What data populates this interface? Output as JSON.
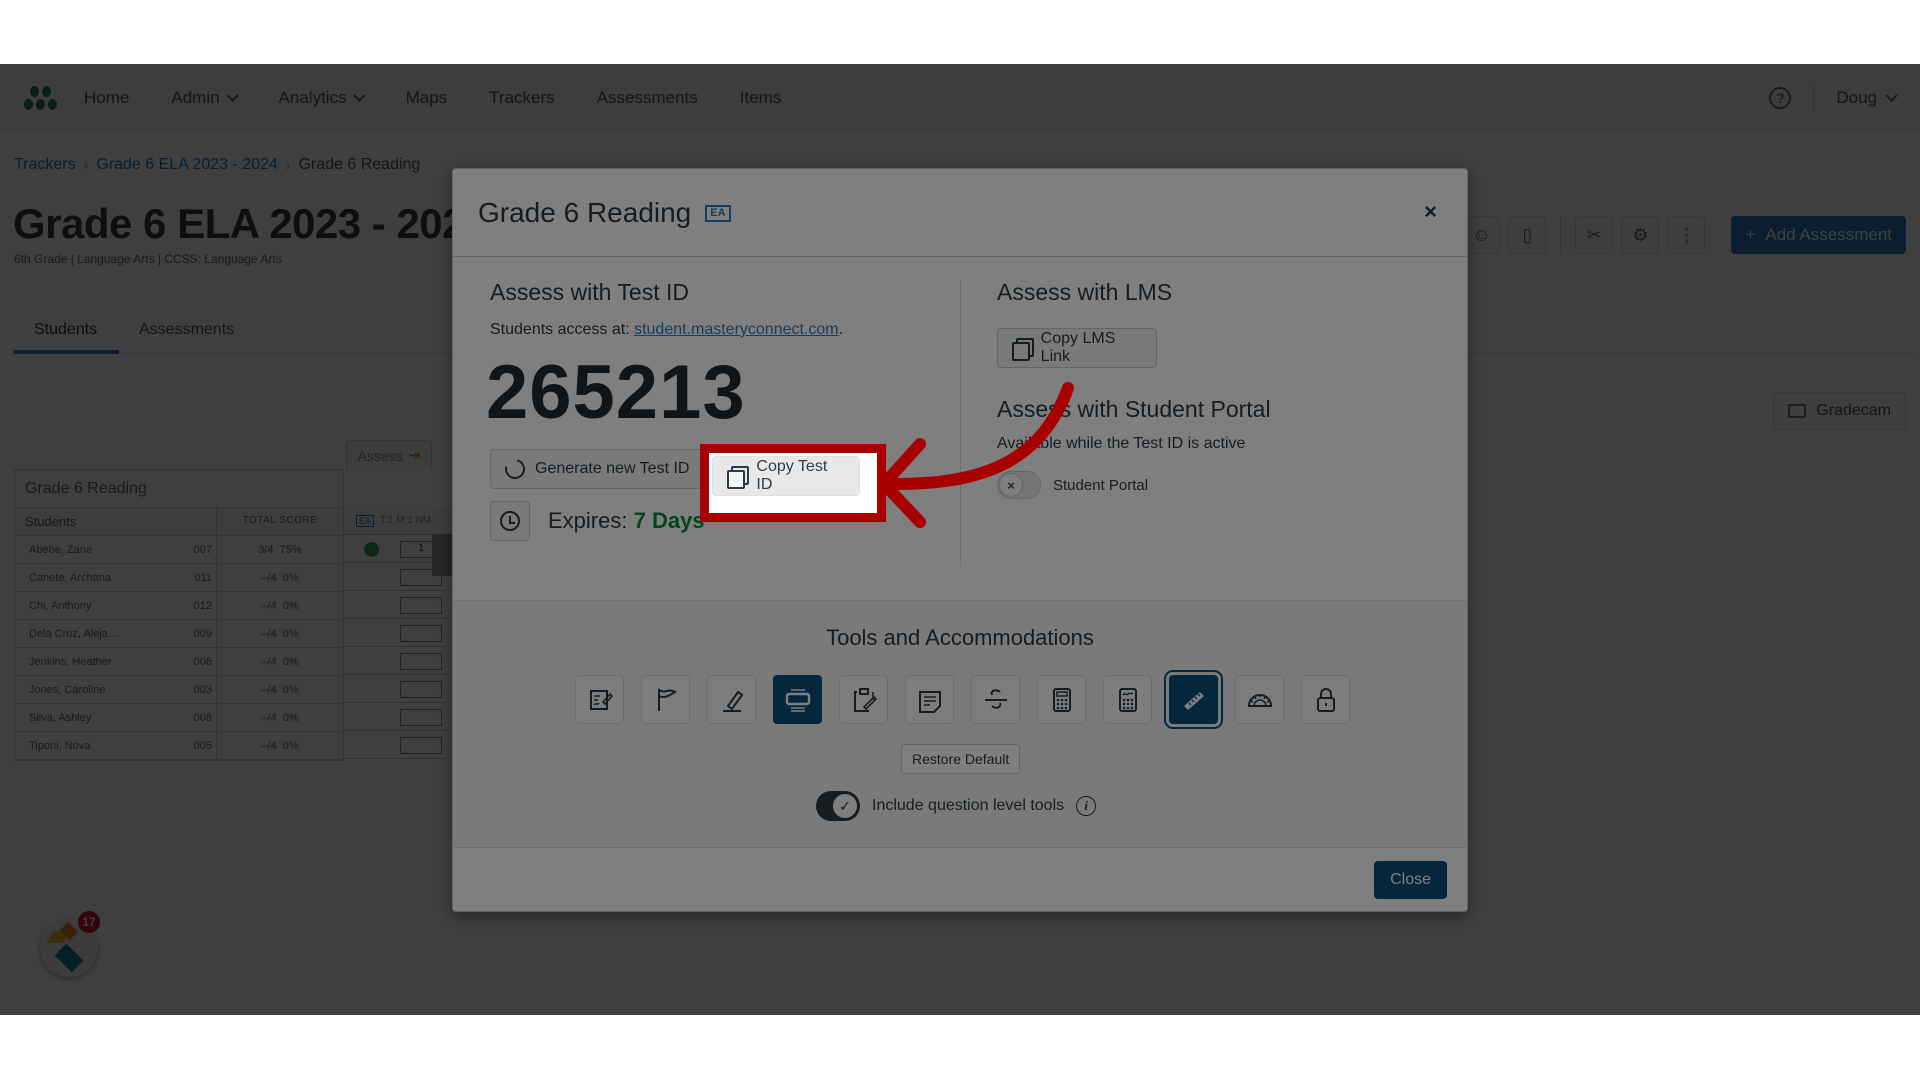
{
  "nav": {
    "items": [
      {
        "label": "Home",
        "dropdown": false
      },
      {
        "label": "Admin",
        "dropdown": true
      },
      {
        "label": "Analytics",
        "dropdown": true
      },
      {
        "label": "Maps",
        "dropdown": false
      },
      {
        "label": "Trackers",
        "dropdown": false
      },
      {
        "label": "Assessments",
        "dropdown": false
      },
      {
        "label": "Items",
        "dropdown": false
      }
    ],
    "help_icon": "question-circle",
    "user": "Doug"
  },
  "breadcrumb": [
    "Trackers",
    "Grade 6 ELA 2023 - 2024",
    "Grade 6 Reading"
  ],
  "page": {
    "title": "Grade 6 ELA 2023 - 2024",
    "subtitle": "6th Grade  |  Language Arts  |  CCSS: Language Arts",
    "tabs": [
      "Students",
      "Assessments"
    ],
    "active_tab": "Students",
    "add_assessment": "Add Assessment",
    "gradecam": "Gradecam"
  },
  "tracker": {
    "assess_tab": "Assess",
    "title": "Grade 6 Reading",
    "headers": {
      "students": "Students",
      "total_score": "TOTAL SCORE",
      "col_badge": "EA",
      "col_meta": "T:1  M:1  NM"
    },
    "rows": [
      {
        "name": "Abebe, Zane",
        "id": "007",
        "score": "3/4",
        "pct": "75%",
        "entry": "1"
      },
      {
        "name": "Canete, Archana",
        "id": "011",
        "score": "–/4",
        "pct": "0%",
        "entry": ""
      },
      {
        "name": "Chi, Anthony",
        "id": "012",
        "score": "–/4",
        "pct": "0%",
        "entry": ""
      },
      {
        "name": "Dela Cruz, Aleja…",
        "id": "009",
        "score": "–/4",
        "pct": "0%",
        "entry": ""
      },
      {
        "name": "Jenkins, Heather",
        "id": "006",
        "score": "–/4",
        "pct": "0%",
        "entry": ""
      },
      {
        "name": "Jones, Caroline",
        "id": "003",
        "score": "–/4",
        "pct": "0%",
        "entry": ""
      },
      {
        "name": "Silva, Ashley",
        "id": "008",
        "score": "–/4",
        "pct": "0%",
        "entry": ""
      },
      {
        "name": "Tiponi, Nova",
        "id": "005",
        "score": "–/4",
        "pct": "0%",
        "entry": ""
      }
    ]
  },
  "chat": {
    "count": "17"
  },
  "modal": {
    "title": "Grade 6 Reading",
    "badge": "EA",
    "close_x": "×",
    "test_id_section": {
      "title": "Assess with Test ID",
      "access_prefix": "Students access at: ",
      "access_link": "student.masteryconnect.com",
      "access_suffix": ".",
      "test_id": "265213",
      "generate_label": "Generate new Test ID",
      "copy_label": "Copy Test ID",
      "expires_label": "Expires: ",
      "expires_value": "7 Days"
    },
    "lms_section": {
      "title": "Assess with LMS",
      "copy_label": "Copy LMS Link"
    },
    "portal_section": {
      "title": "Assess with Student Portal",
      "subtitle": "Available while the Test ID is active",
      "toggle_label": "Student Portal",
      "toggle_on": false
    },
    "tools": {
      "title": "Tools and Accommodations",
      "items": [
        {
          "name": "notepad",
          "active": false
        },
        {
          "name": "flag",
          "active": false
        },
        {
          "name": "highlighter",
          "active": false
        },
        {
          "name": "line-reader",
          "active": true
        },
        {
          "name": "clipboard-edit",
          "active": false
        },
        {
          "name": "sticky-note",
          "active": false
        },
        {
          "name": "strikethrough",
          "active": false
        },
        {
          "name": "basic-calculator",
          "active": false
        },
        {
          "name": "scientific-calculator",
          "active": false
        },
        {
          "name": "ruler",
          "active": true
        },
        {
          "name": "protractor",
          "active": false
        },
        {
          "name": "lock",
          "active": false
        }
      ],
      "restore_label": "Restore Default",
      "question_tools_label": "Include question level tools",
      "question_tools_on": true
    },
    "close_label": "Close"
  },
  "annotation": {
    "highlight_color": "#a80000",
    "target": "Copy Test ID"
  }
}
